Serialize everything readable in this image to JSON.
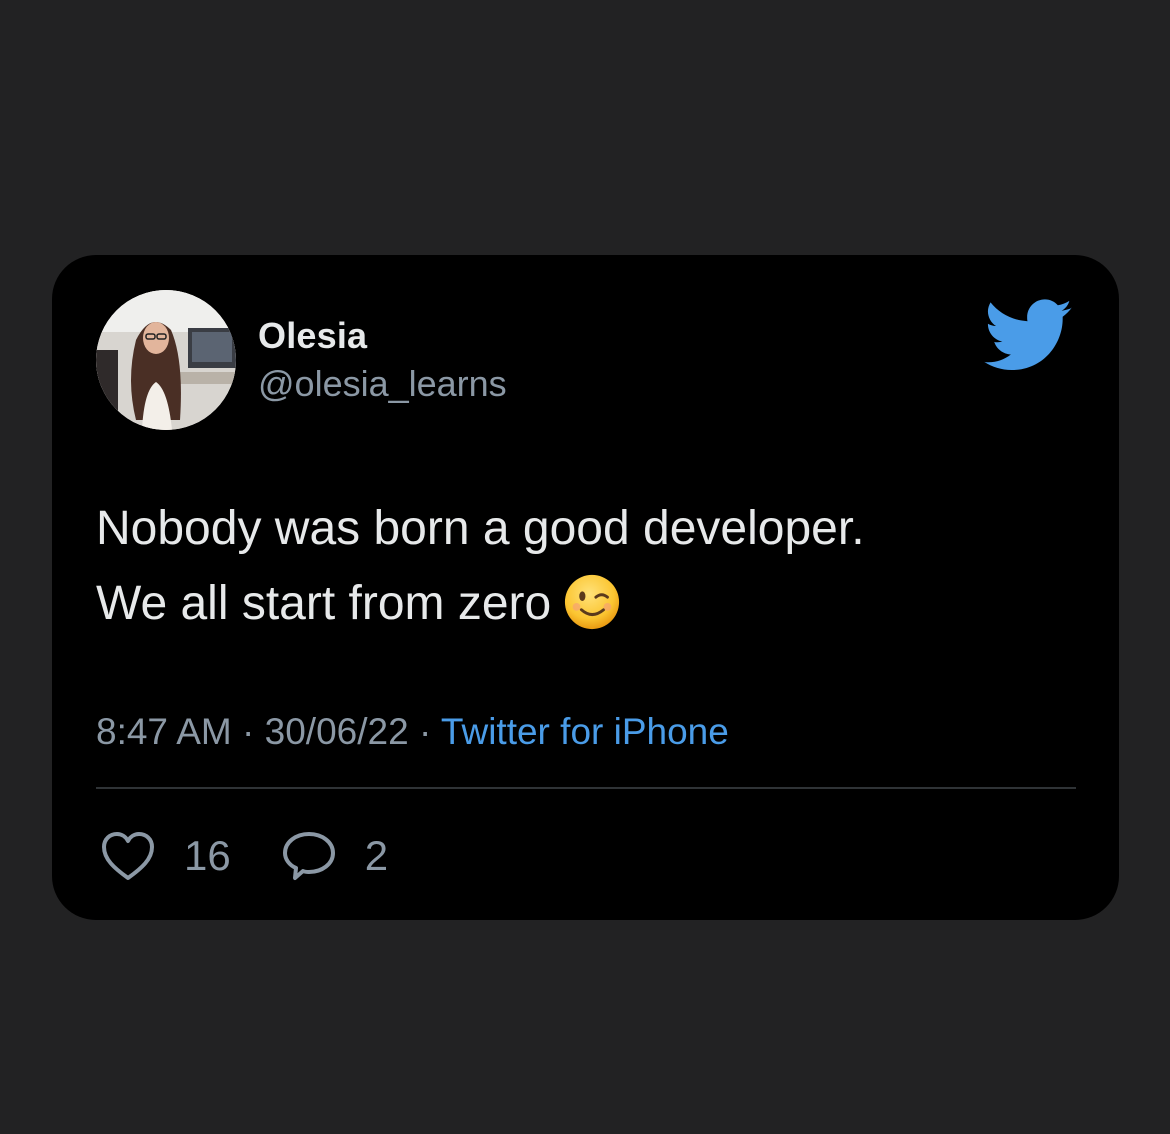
{
  "tweet": {
    "author": {
      "display_name": "Olesia",
      "handle": "@olesia_learns"
    },
    "text": "Nobody was born a good developer.\nWe all start from zero",
    "emoji": "winking-face",
    "time": "8:47 AM",
    "date": "30/06/22",
    "separator": "·",
    "source": "Twitter for iPhone",
    "likes": "16",
    "replies": "2"
  },
  "icons": {
    "brand": "twitter-bird-icon",
    "like": "heart-icon",
    "reply": "comment-bubble-icon"
  },
  "colors": {
    "background": "#222223",
    "card": "#000000",
    "text": "#e7e9ea",
    "secondary_text": "#8b98a5",
    "accent": "#4a9ce8"
  }
}
